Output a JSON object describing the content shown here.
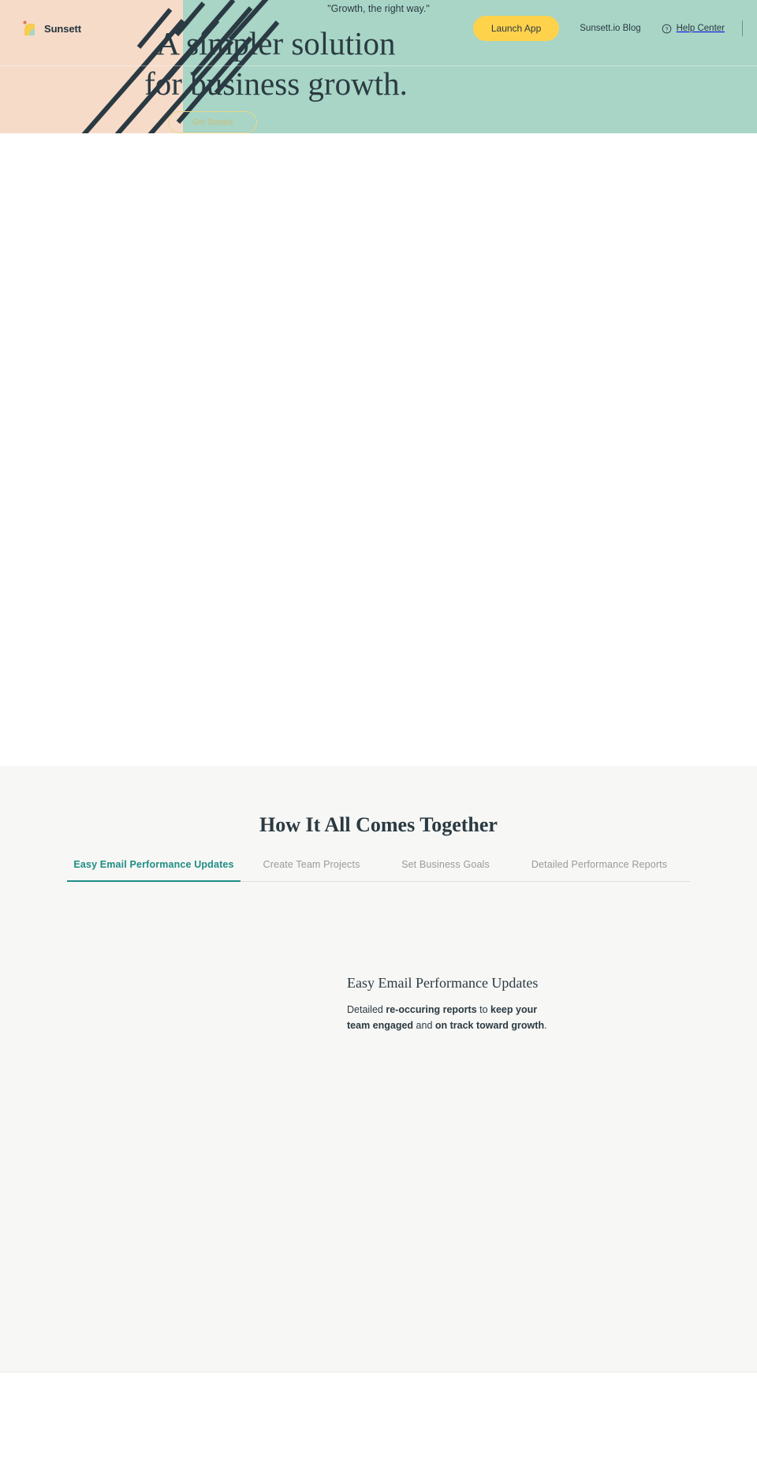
{
  "brand": {
    "name": "Sunsett",
    "logo_icon": "sun-arc-logo-icon",
    "colors": {
      "sun": "#f5cd4f",
      "dot": "#e07a5f",
      "arc": "#a8d5c6"
    }
  },
  "topnav": {
    "launch_label": "Launch App",
    "blog_label": "Sunsett.io Blog",
    "help_label": "Help Center",
    "help_icon": "question-circle-icon",
    "accent": "#ffd24c"
  },
  "hero": {
    "quote": "\"Growth, the right way.\"",
    "title_line1": "A simpler solution",
    "title_line2": "for business growth.",
    "cta_label": "Get Started",
    "bg_teal": "#a8d5c6",
    "bg_peach": "#f6dbc9",
    "stripe_color": "#2b3a42"
  },
  "features": {
    "title": "How It All Comes Together",
    "bg": "#f7f7f5",
    "active_color": "#1f8d85",
    "tabs": [
      {
        "label": "Easy Email Performance Updates",
        "active": true
      },
      {
        "label": "Create Team Projects",
        "active": false
      },
      {
        "label": "Set Business Goals",
        "active": false
      },
      {
        "label": "Detailed Performance Reports",
        "active": false
      }
    ],
    "panel": {
      "heading": "Easy Email Performance Updates",
      "body_part1": "Detailed ",
      "body_bold1": "re-occuring reports",
      "body_part2": " to ",
      "body_bold2": "keep your team engaged",
      "body_part3": " and ",
      "body_bold3": "on track toward growth",
      "body_part4": "."
    }
  }
}
